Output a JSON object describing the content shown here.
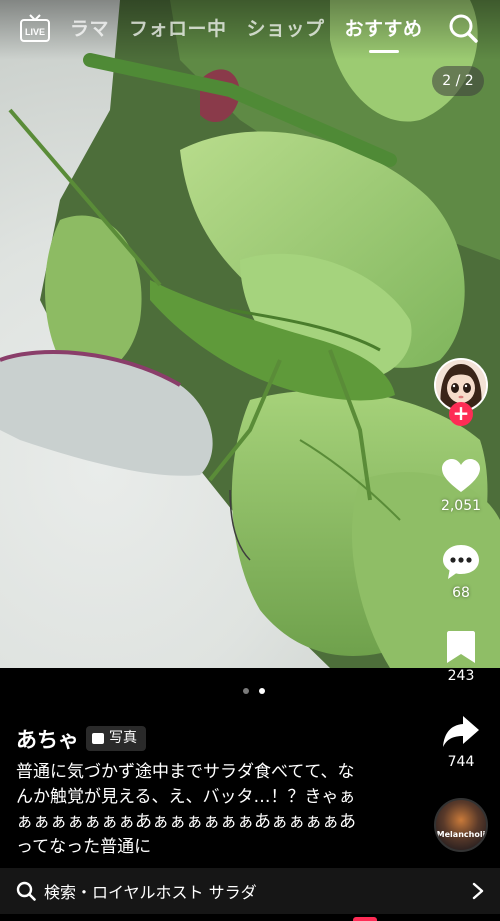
{
  "topnav": {
    "live_label": "LIVE",
    "tabs": [
      {
        "label": "ラマ"
      },
      {
        "label": "フォロー中"
      },
      {
        "label": "ショップ"
      },
      {
        "label": "おすすめ",
        "active": true
      }
    ]
  },
  "page_counter": "2 / 2",
  "actions": {
    "likes": "2,051",
    "comments": "68",
    "saves": "243",
    "shares": "744"
  },
  "post": {
    "username": "あちゃ",
    "badge": "写真",
    "caption": "普通に気づかず途中までサラダ食べてて、なんか触覚が見える、え、バッタ…！？きゃぁぁぁぁぁぁぁぁあぁぁぁぁぁぁあぁぁぁぁあってなった普通に",
    "music_label": "Melancholi"
  },
  "searchbar": {
    "label": "検索・ロイヤルホスト サラダ"
  },
  "colors": {
    "accent": "#fe2c55",
    "background": "#000000",
    "search_bg": "#161616"
  }
}
